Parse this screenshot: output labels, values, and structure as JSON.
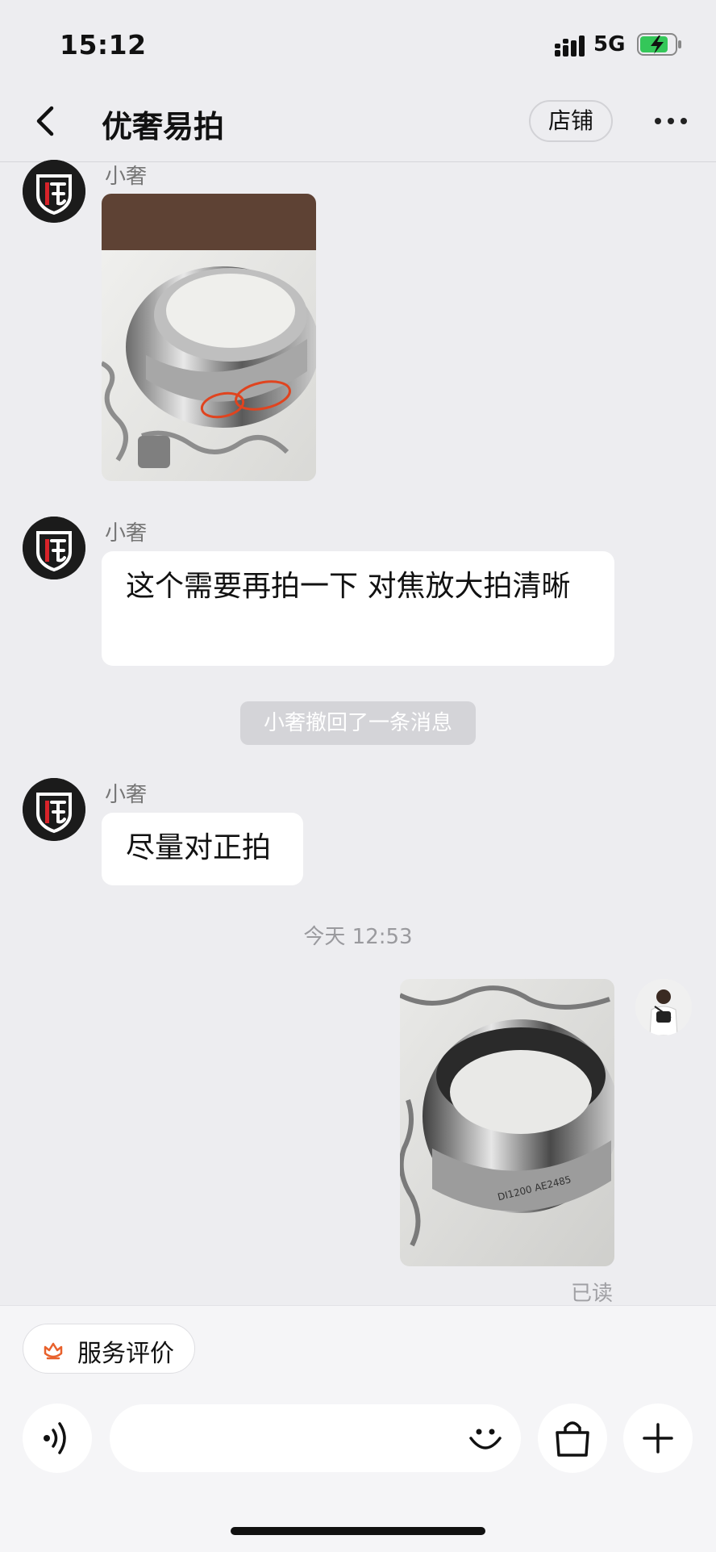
{
  "status_bar": {
    "time": "15:12",
    "network": "5G",
    "battery_icon": "battery-charging-icon",
    "battery_color": "#34c759"
  },
  "header": {
    "title": "优奢易拍",
    "shop_button": "店铺",
    "back_icon": "back-arrow-icon",
    "more_icon": "more-dots-icon"
  },
  "messages": {
    "msg1": {
      "sender": "小奢",
      "type": "image"
    },
    "msg2": {
      "sender": "小奢",
      "text": "这个需要再拍一下 对焦放大拍清晰"
    },
    "recall_notice": "小奢撤回了一条消息",
    "msg3": {
      "sender": "小奢",
      "text": "尽量对正拍"
    },
    "timestamp": "今天 12:53",
    "msg4": {
      "type": "image",
      "read_status": "已读"
    }
  },
  "bottom": {
    "service_rating": "服务评价",
    "input_placeholder": ""
  },
  "colors": {
    "background": "#ededf0",
    "bubble": "#ffffff",
    "accent_orange": "#e8612c"
  }
}
